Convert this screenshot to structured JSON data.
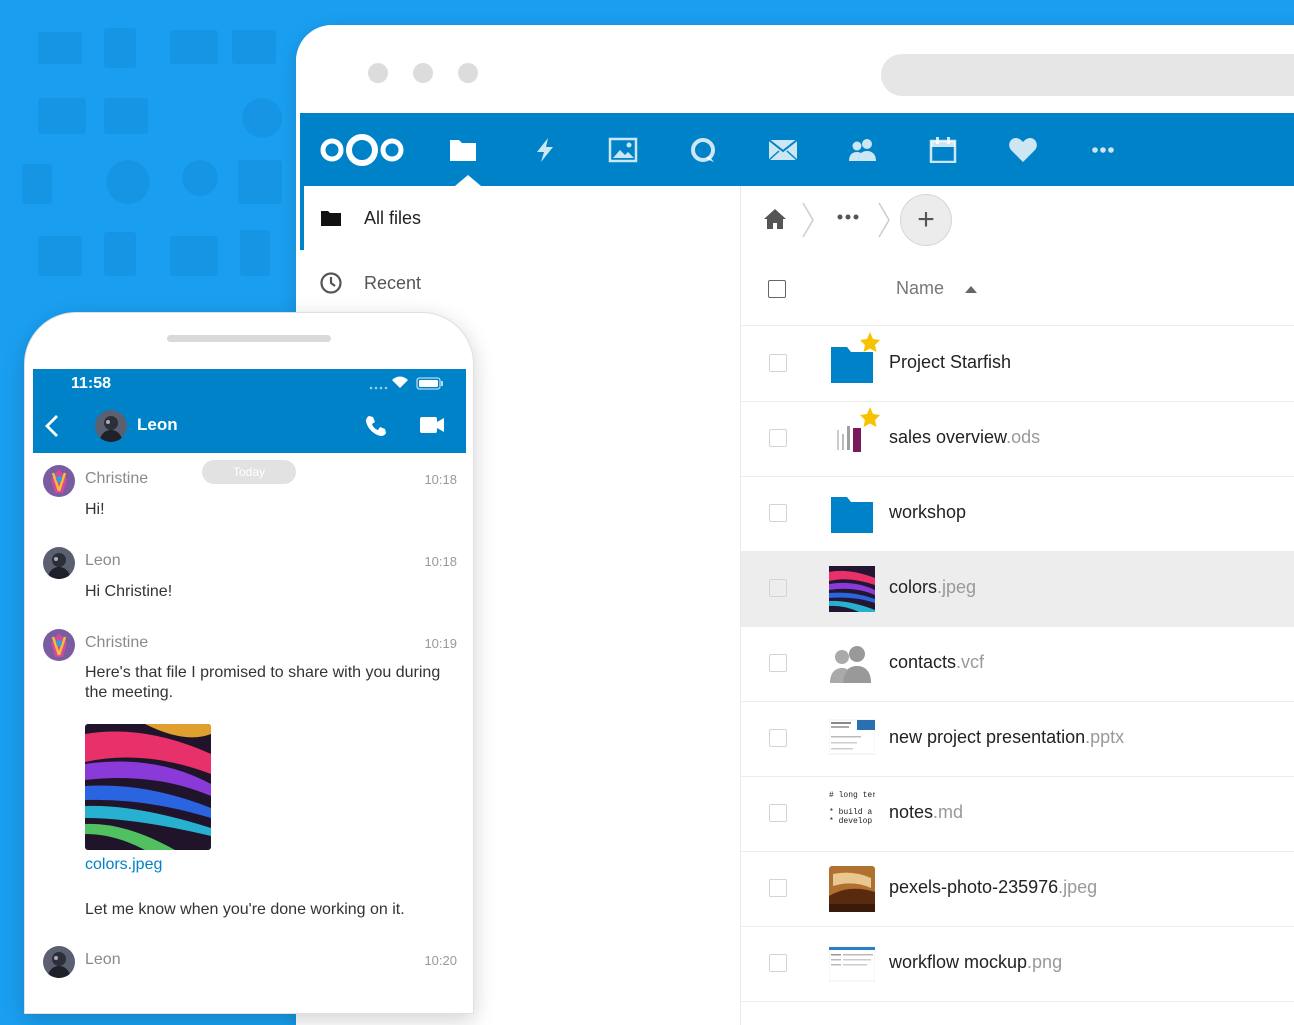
{
  "desktop": {
    "nav_icons": [
      "files-icon",
      "activity-icon",
      "photos-icon",
      "talk-icon",
      "mail-icon",
      "contacts-icon",
      "calendar-icon",
      "favorites-icon",
      "more-icon"
    ],
    "sidebar": {
      "items": [
        {
          "label": "All files",
          "icon": "folder-icon"
        },
        {
          "label": "Recent",
          "icon": "clock-icon"
        }
      ]
    },
    "breadcrumb": {
      "add_label": "+"
    },
    "files": {
      "column_name": "Name",
      "rows": [
        {
          "base": "Project Starfish",
          "ext": "",
          "type": "folder",
          "starred": true
        },
        {
          "base": "sales overview",
          "ext": ".ods",
          "type": "spreadsheet",
          "starred": true
        },
        {
          "base": "workshop",
          "ext": "",
          "type": "folder",
          "starred": false
        },
        {
          "base": "colors",
          "ext": ".jpeg",
          "type": "image",
          "starred": false,
          "highlighted": true
        },
        {
          "base": "contacts",
          "ext": ".vcf",
          "type": "contacts",
          "starred": false
        },
        {
          "base": "new project presentation",
          "ext": ".pptx",
          "type": "presentation",
          "starred": false
        },
        {
          "base": "notes",
          "ext": ".md",
          "type": "markdown",
          "starred": false
        },
        {
          "base": "pexels-photo-235976",
          "ext": ".jpeg",
          "type": "photo",
          "starred": false
        },
        {
          "base": "workflow mockup",
          "ext": ".png",
          "type": "mockup",
          "starred": false
        }
      ],
      "thumb_text": {
        "notes": [
          "# long term",
          "* build a ne",
          "* develop a"
        ]
      }
    }
  },
  "phone": {
    "time": "11:58",
    "contact": "Leon",
    "today_label": "Today",
    "messages": [
      {
        "author": "Christine",
        "time": "10:18",
        "text": "Hi!"
      },
      {
        "author": "Leon",
        "time": "10:18",
        "text": "Hi Christine!"
      },
      {
        "author": "Christine",
        "time": "10:19",
        "text": "Here's that file I promised to share with you during the meeting."
      },
      {
        "author": "Leon",
        "time": "10:20",
        "text": ""
      }
    ],
    "attachment": "colors.jpeg",
    "followup": "Let me know when you're done working on it."
  },
  "colors": {
    "brand": "#0082c9",
    "background": "#1a9ff0",
    "star": "#f8c200"
  }
}
